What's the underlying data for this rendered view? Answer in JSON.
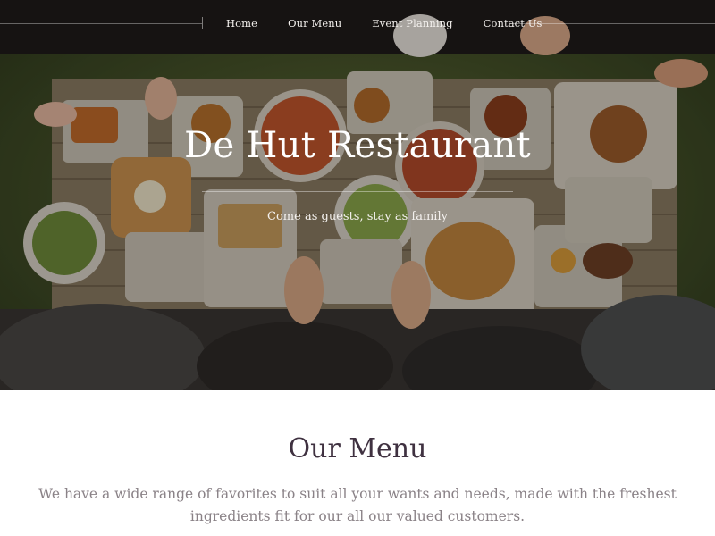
{
  "nav": {
    "items": [
      {
        "label": "Home"
      },
      {
        "label": "Our Menu"
      },
      {
        "label": "Event Planning"
      },
      {
        "label": "Contact Us"
      }
    ]
  },
  "hero": {
    "title": "De Hut Restaurant",
    "subtitle": "Come as guests, stay as family"
  },
  "menu": {
    "title": "Our Menu",
    "description": "We have a wide range of favorites to suit all your wants and needs, made with the freshest ingredients fit for our all our valued customers."
  },
  "colors": {
    "hero_text": "#ffffff",
    "heading": "#3f3140",
    "body_text": "#8a8287",
    "grass": "#4a5a2e",
    "table_wood": "#7a6a55"
  }
}
